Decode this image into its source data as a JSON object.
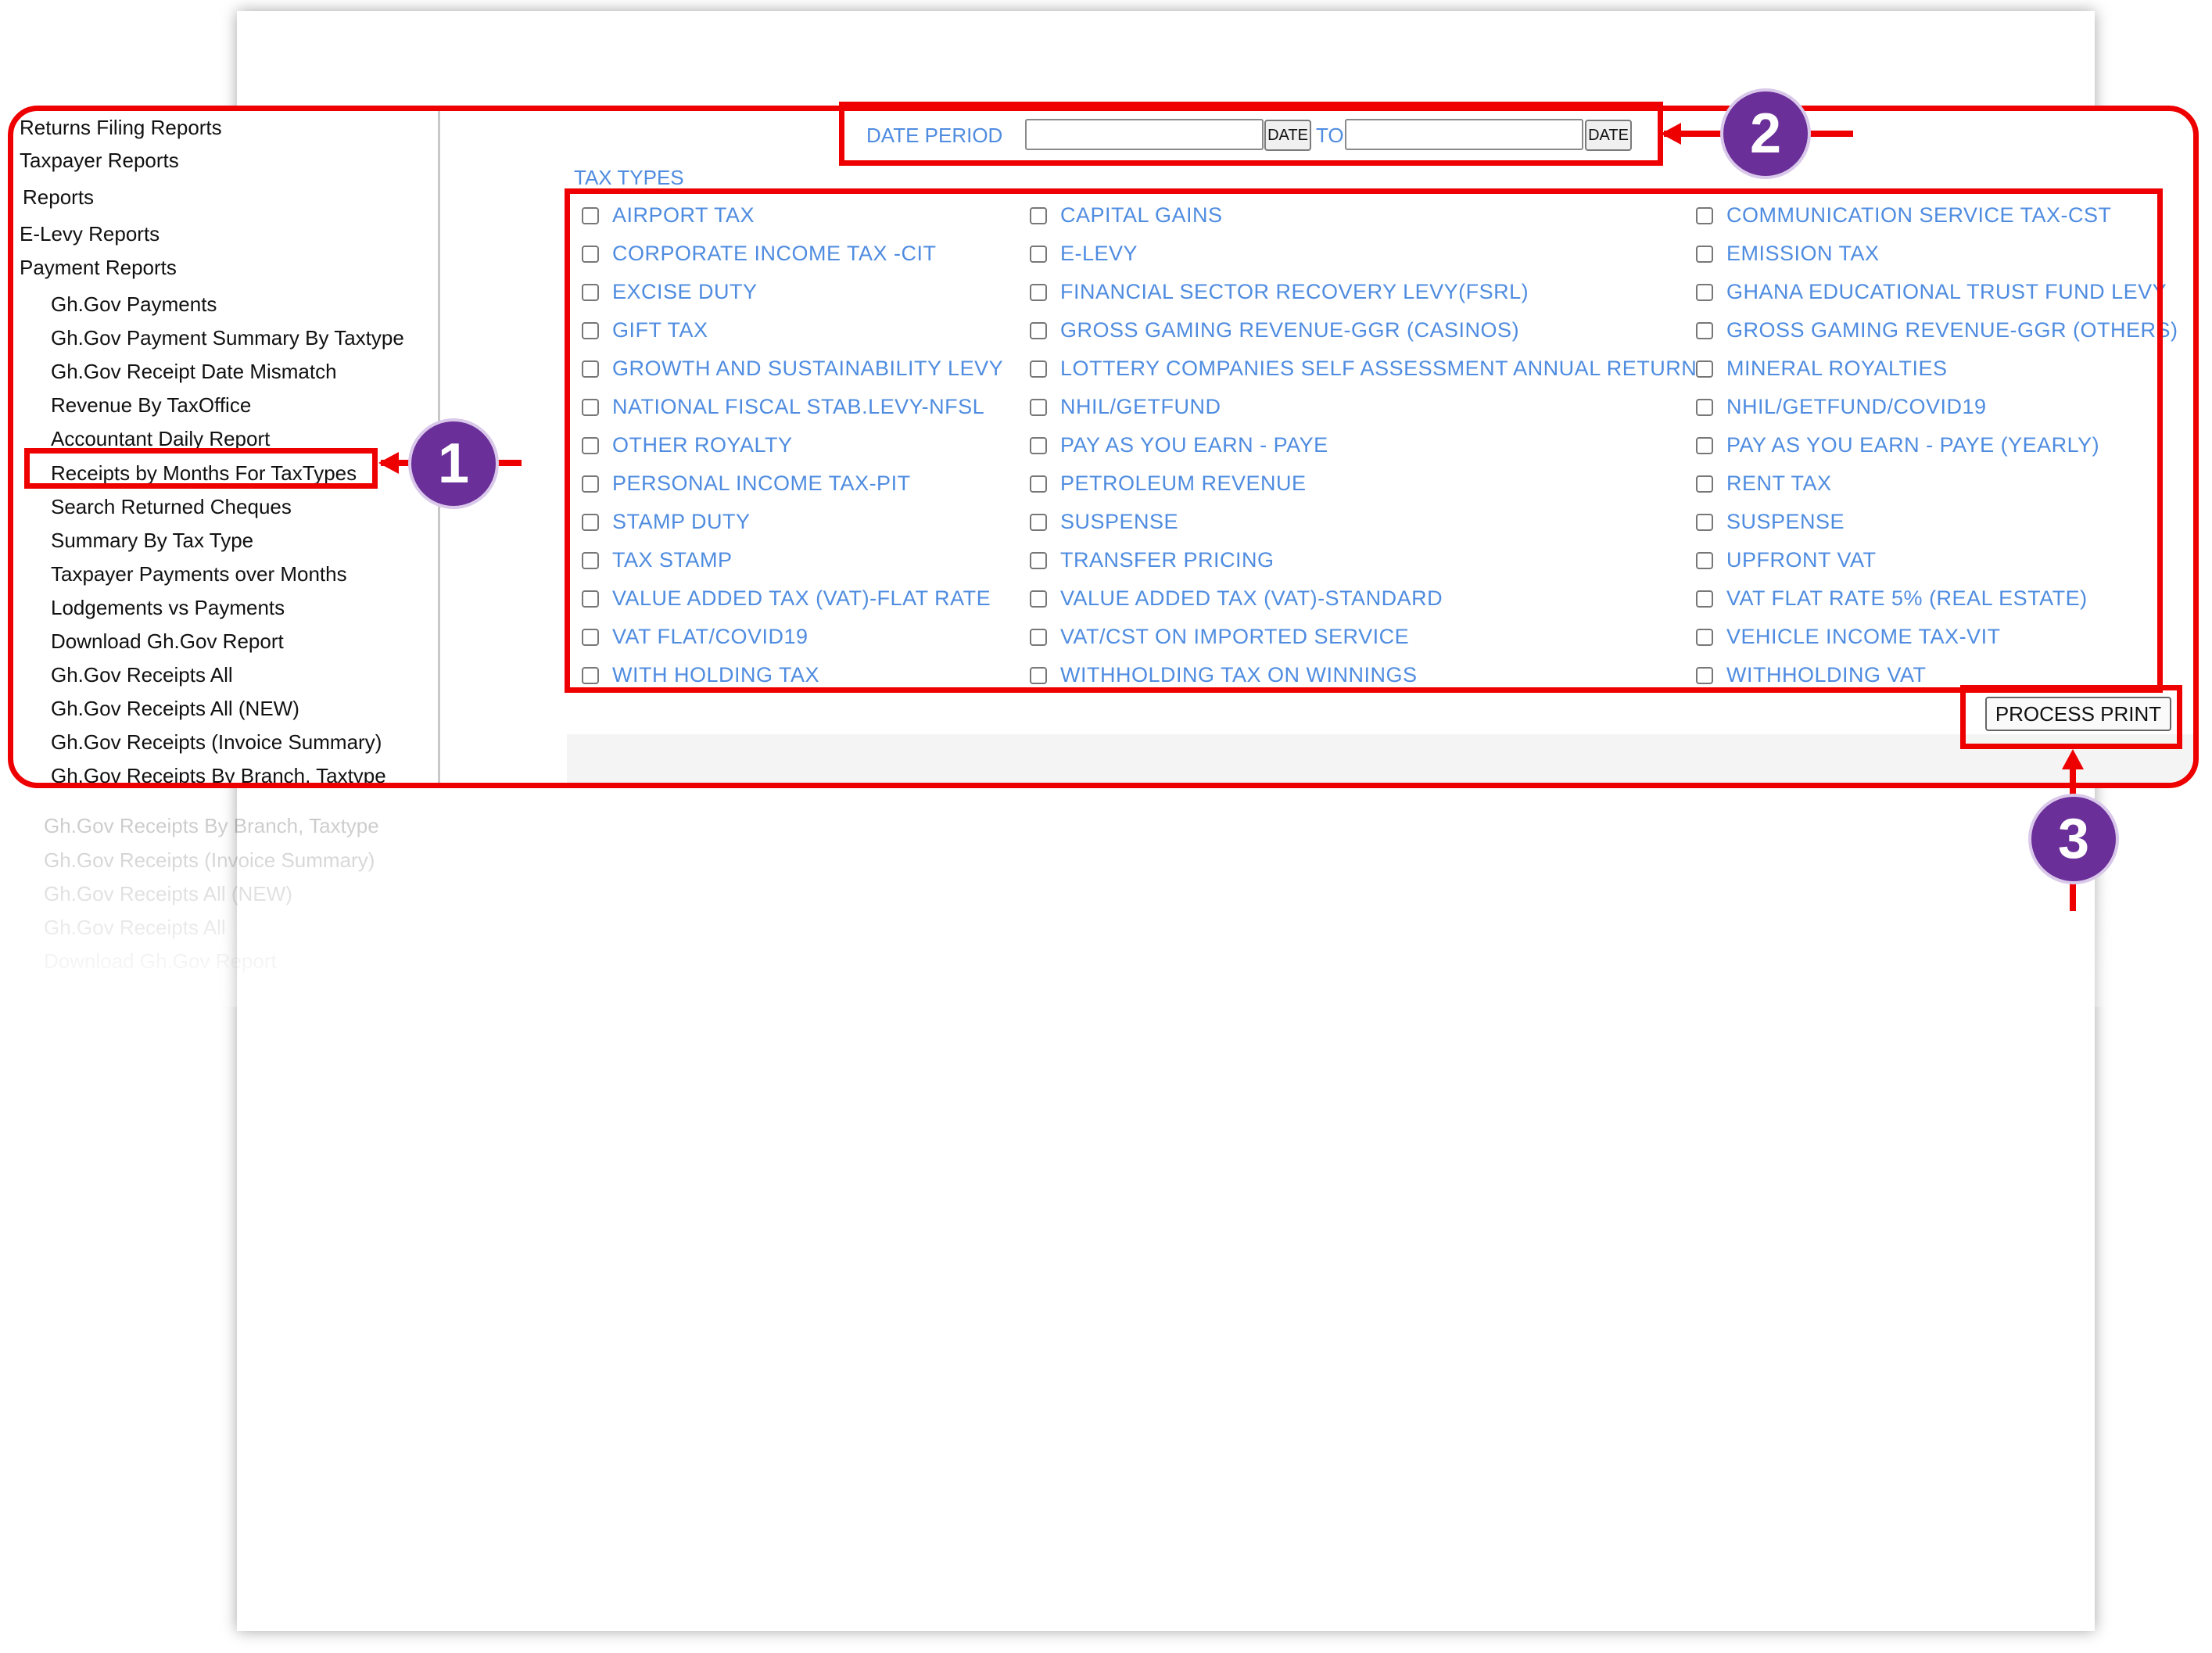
{
  "sidebar": {
    "items": [
      "Returns Filing Reports",
      "Taxpayer Reports",
      "Reports",
      "E-Levy Reports",
      "Payment Reports",
      "Gh.Gov Payments",
      "Gh.Gov Payment Summary By Taxtype",
      "Gh.Gov Receipt Date Mismatch",
      "Revenue By TaxOffice",
      "Accountant Daily Report",
      "Receipts by Months For TaxTypes",
      "Search Returned Cheques",
      "Summary By Tax Type",
      "Taxpayer Payments over Months",
      "Lodgements vs Payments",
      "Download Gh.Gov Report",
      "Gh.Gov Receipts All",
      "Gh.Gov Receipts All (NEW)",
      "Gh.Gov Receipts (Invoice Summary)",
      "Gh.Gov Receipts By Branch, Taxtype"
    ]
  },
  "date_period": {
    "label": "DATE PERIOD",
    "to_label": "TO",
    "from_button": "DATE",
    "to_button": "DATE",
    "from_value": "",
    "to_value": ""
  },
  "tax_types": {
    "heading": "TAX TYPES",
    "items": [
      "AIRPORT TAX",
      "CAPITAL GAINS",
      "COMMUNICATION SERVICE TAX-CST",
      "CORPORATE INCOME TAX -CIT",
      "E-LEVY",
      "EMISSION TAX",
      "EXCISE DUTY",
      "FINANCIAL SECTOR RECOVERY LEVY(FSRL)",
      "GHANA EDUCATIONAL TRUST FUND LEVY",
      "GIFT TAX",
      "GROSS GAMING REVENUE-GGR (CASINOS)",
      "GROSS GAMING REVENUE-GGR (OTHERS)",
      "GROWTH AND SUSTAINABILITY LEVY",
      "LOTTERY COMPANIES SELF ASSESSMENT ANNUAL RETURN",
      "MINERAL ROYALTIES",
      "NATIONAL FISCAL STAB.LEVY-NFSL",
      "NHIL/GETFUND",
      "NHIL/GETFUND/COVID19",
      "OTHER ROYALTY",
      "PAY AS YOU EARN - PAYE",
      "PAY AS YOU EARN - PAYE (YEARLY)",
      "PERSONAL INCOME TAX-PIT",
      "PETROLEUM REVENUE",
      "RENT TAX",
      "STAMP DUTY",
      "SUSPENSE",
      "SUSPENSE",
      "TAX STAMP",
      "TRANSFER PRICING",
      "UPFRONT VAT",
      "VALUE ADDED TAX (VAT)-FLAT RATE",
      "VALUE ADDED TAX (VAT)-STANDARD",
      "VAT FLAT RATE 5% (REAL ESTATE)",
      "VAT FLAT/COVID19",
      "VAT/CST ON IMPORTED SERVICE",
      "VEHICLE INCOME TAX-VIT",
      "WITH HOLDING TAX",
      "WITHHOLDING TAX ON WINNINGS",
      "WITHHOLDING VAT"
    ]
  },
  "actions": {
    "process_print": "PROCESS PRINT"
  },
  "callouts": [
    "1",
    "2",
    "3"
  ],
  "colors": {
    "accent_red": "#ee0000",
    "link_blue": "#4f8ce0",
    "callout_purple": "#6a2f98"
  }
}
